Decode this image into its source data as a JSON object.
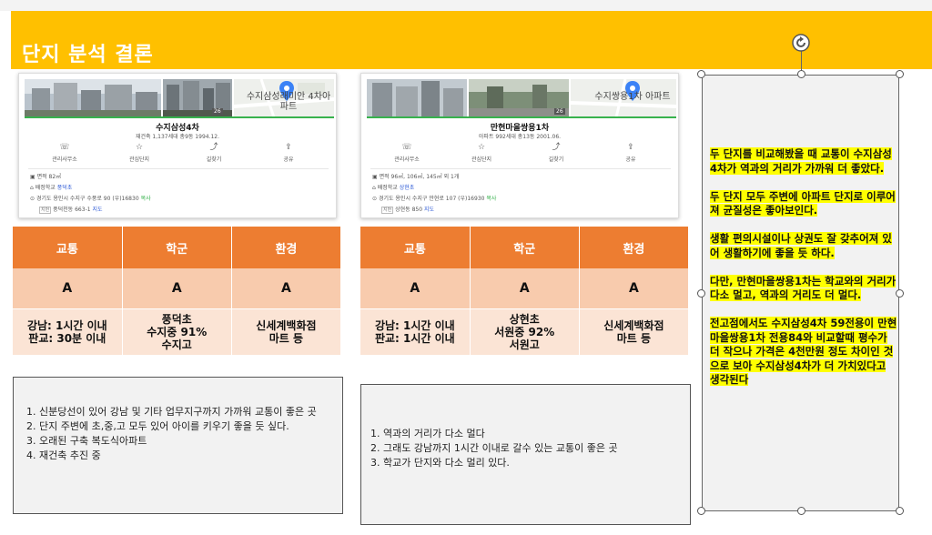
{
  "slide": {
    "title": "단지 분석 결론"
  },
  "cards": [
    {
      "map_label": "수지삼성래미안 4차아파트",
      "photo_num": "26",
      "name": "수지삼성4차",
      "sub": "재건축  1,137세대  총9동  1994.12.",
      "actions": [
        "관리사무소",
        "관심단지",
        "길찾기",
        "공유"
      ],
      "area": "면적 82㎡",
      "school_label": "배정학교",
      "school": "풍덕초",
      "address": "경기도 용인시 수지구 수풍로 90 (우)16830",
      "copy": "복사",
      "lot_tag": "지번",
      "lot": "풍덕천동 663-1",
      "map_link": "지도"
    },
    {
      "map_label": "수지쌍용1차 아파트",
      "photo_num": "26",
      "name": "만현마을쌍용1차",
      "sub": "아파트  992세대  총13동  2001.06.",
      "actions": [
        "관리사무소",
        "관심단지",
        "길찾기",
        "공유"
      ],
      "area": "면적 96㎡, 106㎡, 145㎡ 외 1개",
      "school_label": "배정학교",
      "school": "상현초",
      "address": "경기도 용인시 수지구 만현로 107 (우)16930",
      "copy": "복사",
      "lot_tag": "지번",
      "lot": "상현동 850",
      "map_link": "지도"
    }
  ],
  "tables": [
    {
      "headers": [
        "교통",
        "학군",
        "환경"
      ],
      "grades": [
        "A",
        "A",
        "A"
      ],
      "details": [
        [
          "강남: 1시간 이내",
          "판교: 30분 이내"
        ],
        [
          "풍덕초",
          "수지중 91%",
          "수지고"
        ],
        [
          "신세계백화점",
          "마트 등"
        ]
      ]
    },
    {
      "headers": [
        "교통",
        "학군",
        "환경"
      ],
      "grades": [
        "A",
        "A",
        "A"
      ],
      "details": [
        [
          "강남: 1시간 이내",
          "판교: 1시간 이내"
        ],
        [
          "상현초",
          "서원중 92%",
          "서원고"
        ],
        [
          "신세계백화점",
          "마트 등"
        ]
      ]
    }
  ],
  "notes_left": [
    "신분당선이 있어 강남 및 기타 업무지구까지 가까워 교통이 좋은 곳",
    "단지 주변에 초,중,고 모두 있어 아이를 키우기 좋을 듯 싶다.",
    "오래된 구축 복도식아파트",
    "재건축 추진 중"
  ],
  "notes_right": [
    "역과의 거리가 다소 멀다",
    "그래도 강남까지 1시간 이내로 갈수 있는 교통이 좋은 곳",
    "학교가 단지와 다소 멀리 있다."
  ],
  "conclusion": [
    "두 단지를 비교해봤을 때 교통이 수지삼성4차가 역과의 거리가 가까워 더 좋았다.",
    "두 단지 모두 주변에 아파트 단지로 이루어져 균질성은 좋아보인다.",
    "생활 편의시설이나 상권도 잘 갖추어져 있어 생활하기에 좋을 듯 하다.",
    "다만, 만현마을쌍용1차는 학교와의 거리가 다소 멀고, 역과의 거리도 더 멀다.",
    "전고점에서도 수지삼성4차 59전용이 만현마을쌍용1차 전용84와 비교할때  평수가 더 작으나 가격은 4천만원 정도 차이인 것으로 보아 수지삼성4차가 더 가치있다고 생각된다"
  ],
  "colors": {
    "header": "#ffc000",
    "table_header": "#ed7d31",
    "grade_row": "#f8cbad",
    "detail_row": "#fbe4d5",
    "highlight": "#ffff00"
  }
}
